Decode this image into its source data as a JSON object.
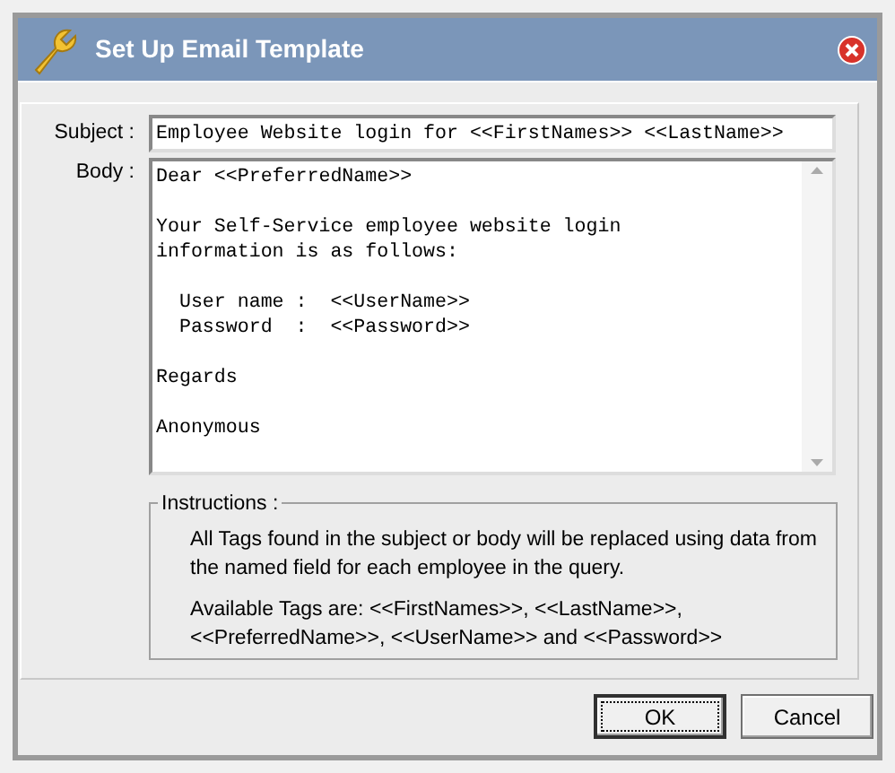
{
  "window": {
    "title": "Set Up Email Template"
  },
  "subject": {
    "label": "Subject :",
    "value": "Employee Website login for <<FirstNames>> <<LastName>>"
  },
  "body": {
    "label": "Body :",
    "value": "Dear <<PreferredName>>\n\nYour Self-Service employee website login\ninformation is as follows:\n\n  User name :  <<UserName>>\n  Password  :  <<Password>>\n\nRegards\n\nAnonymous"
  },
  "instructions": {
    "title": "Instructions :",
    "paragraphs": [
      "All Tags found in the subject or body will be replaced using data from the named field for each employee in the query.",
      "Available Tags are:  <<FirstNames>>, <<LastName>>, <<PreferredName>>, <<UserName>> and <<Password>>"
    ]
  },
  "buttons": [
    {
      "label": "OK",
      "focused": true
    },
    {
      "label": "Cancel",
      "focused": false
    }
  ]
}
